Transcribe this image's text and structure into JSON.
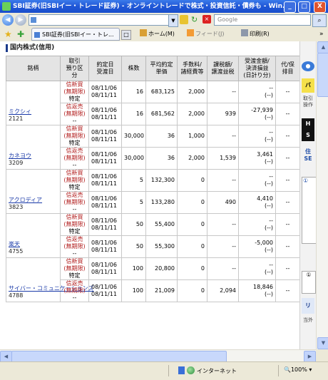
{
  "window": {
    "title": "SBI証券(旧SBIイー・トレード証券) - オンライントレードで株式・投資信託・債券も - Win...",
    "minimize": "_",
    "maximize": "□",
    "close": "X"
  },
  "addressbar": {
    "url": "",
    "search_placeholder": "Google"
  },
  "commandbar": {
    "tab_label": "SBI証券(旧SBIイー・トレ...",
    "home": "ホーム(M)",
    "feed": "フィード(J)",
    "print": "印刷(R)"
  },
  "page": {
    "section_title": "国内株式(信用)",
    "headers": {
      "name": "銘柄",
      "kind": "取引\n預り区\n分",
      "date": "約定日\n受渡日",
      "qty": "株数",
      "price": "平均約定\n単価",
      "fee": "手数料/\n諸経費等",
      "tax": "課税額/\n譲渡益税",
      "amount": "受渡金額/\n決済損益\n(日計り分)",
      "agent": "代/保\n排目"
    },
    "stocks": [
      {
        "name": "ミクシィ",
        "code": "2121",
        "rows": [
          {
            "kind": "信新買",
            "kind2": "(無期限)",
            "kind3": "特定",
            "date1": "08/11/06",
            "date2": "08/11/11",
            "qty": "16",
            "price": "683,125",
            "fee": "2,000",
            "tax": "--",
            "amount1": "--",
            "amount2": "(--)",
            "agent": "--"
          },
          {
            "kind": "信返売",
            "kind2": "(無期限)",
            "kind3": "--",
            "date1": "08/11/06",
            "date2": "08/11/11",
            "qty": "16",
            "price": "681,562",
            "fee": "2,000",
            "tax": "939",
            "amount1": "-27,939",
            "amount2": "(--)",
            "agent": "--"
          }
        ]
      },
      {
        "name": "カネヨウ",
        "code": "3209",
        "rows": [
          {
            "kind": "信新買",
            "kind2": "(無期限)",
            "kind3": "特定",
            "date1": "08/11/06",
            "date2": "08/11/11",
            "qty": "30,000",
            "price": "36",
            "fee": "1,000",
            "tax": "--",
            "amount1": "--",
            "amount2": "(--)",
            "agent": "--"
          },
          {
            "kind": "信返売",
            "kind2": "(無期限)",
            "kind3": "--",
            "date1": "08/11/06",
            "date2": "08/11/11",
            "qty": "30,000",
            "price": "36",
            "fee": "2,000",
            "tax": "1,539",
            "amount1": "3,461",
            "amount2": "(--)",
            "agent": "--"
          }
        ]
      },
      {
        "name": "アクロディア",
        "code": "3823",
        "rows": [
          {
            "kind": "信新買",
            "kind2": "(無期限)",
            "kind3": "特定",
            "date1": "08/11/06",
            "date2": "08/11/11",
            "qty": "5",
            "price": "132,300",
            "fee": "0",
            "tax": "--",
            "amount1": "--",
            "amount2": "(--)",
            "agent": "--"
          },
          {
            "kind": "信返売",
            "kind2": "(無期限)",
            "kind3": "--",
            "date1": "08/11/06",
            "date2": "08/11/11",
            "qty": "5",
            "price": "133,280",
            "fee": "0",
            "tax": "490",
            "amount1": "4,410",
            "amount2": "(--)",
            "agent": "--"
          }
        ]
      },
      {
        "name": "楽天",
        "code": "4755",
        "rows": [
          {
            "kind": "信新買",
            "kind2": "(無期限)",
            "kind3": "特定",
            "date1": "08/11/06",
            "date2": "08/11/11",
            "qty": "50",
            "price": "55,400",
            "fee": "0",
            "tax": "--",
            "amount1": "--",
            "amount2": "(--)",
            "agent": "--"
          },
          {
            "kind": "信返売",
            "kind2": "(無期限)",
            "kind3": "--",
            "date1": "08/11/06",
            "date2": "08/11/11",
            "qty": "50",
            "price": "55,300",
            "fee": "0",
            "tax": "--",
            "amount1": "-5,000",
            "amount2": "(--)",
            "agent": "--"
          }
        ]
      },
      {
        "name": "サイバー・コミュニケーションズ",
        "code": "4788",
        "rows": [
          {
            "kind": "信新買",
            "kind2": "(無期限)",
            "kind3": "特定",
            "date1": "08/11/06",
            "date2": "08/11/11",
            "qty": "100",
            "price": "20,800",
            "fee": "0",
            "tax": "--",
            "amount1": "--",
            "amount2": "(--)",
            "agent": "--"
          },
          {
            "kind": "信返売",
            "kind2": "(無期限)",
            "kind3": "--",
            "date1": "08/11/06",
            "date2": "08/11/11",
            "qty": "100",
            "price": "21,009",
            "fee": "0",
            "tax": "2,094",
            "amount1": "18,846",
            "amount2": "(--)",
            "agent": "--"
          }
        ]
      }
    ]
  },
  "sidebar": {
    "yellow": "バ",
    "text1": "取引\n操作",
    "black": "H\nS",
    "text2": "住\nSE",
    "info_label": "①",
    "info2_label": "①",
    "blue2": "リ",
    "text3": "当外"
  },
  "statusbar": {
    "zone": "インターネット",
    "zoom": "100%"
  }
}
